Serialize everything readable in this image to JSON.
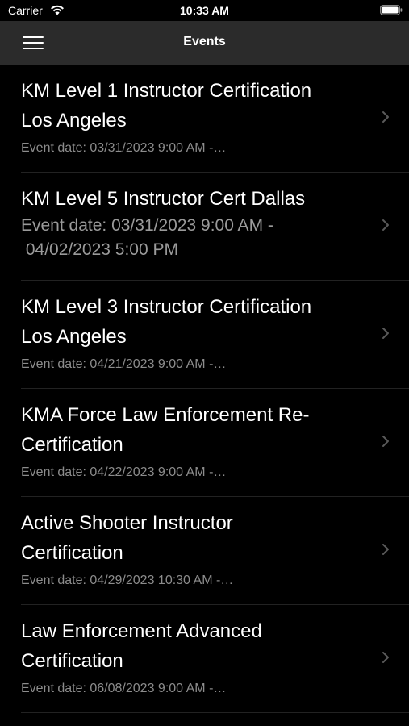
{
  "status_bar": {
    "carrier": "Carrier",
    "time": "10:33 AM",
    "icons": [
      "wifi-icon",
      "battery-icon"
    ]
  },
  "nav": {
    "title": "Events",
    "menu_icon": "hamburger-menu-icon"
  },
  "events": [
    {
      "title_line1": "KM Level 1 Instructor Certification",
      "title_line2": "Los Angeles",
      "date": "Event date: 03/31/2023 9:00 AM -…"
    },
    {
      "title_line1": "KM Level 5 Instructor Cert Dallas",
      "date_line1": "Event date: 03/31/2023 9:00 AM -",
      "date_line2": " 04/02/2023 5:00 PM"
    },
    {
      "title_line1": "KM Level 3 Instructor Certification",
      "title_line2": "Los Angeles",
      "date": "Event date: 04/21/2023 9:00 AM -…"
    },
    {
      "title_line1": "KMA Force Law Enforcement Re-",
      "title_line2": "Certification",
      "date": "Event date: 04/22/2023 9:00 AM -…"
    },
    {
      "title_line1": "Active Shooter Instructor",
      "title_line2": "Certification",
      "date": "Event date: 04/29/2023 10:30 AM -…"
    },
    {
      "title_line1": "Law Enforcement Advanced",
      "title_line2": "Certification",
      "date": "Event date: 06/08/2023 9:00 AM -…"
    }
  ],
  "colors": {
    "background": "#000000",
    "nav_bar": "#2b2b2b",
    "title_text": "#ffffff",
    "secondary_text": "#8c8c8c",
    "chevron": "#5a5a5a"
  }
}
